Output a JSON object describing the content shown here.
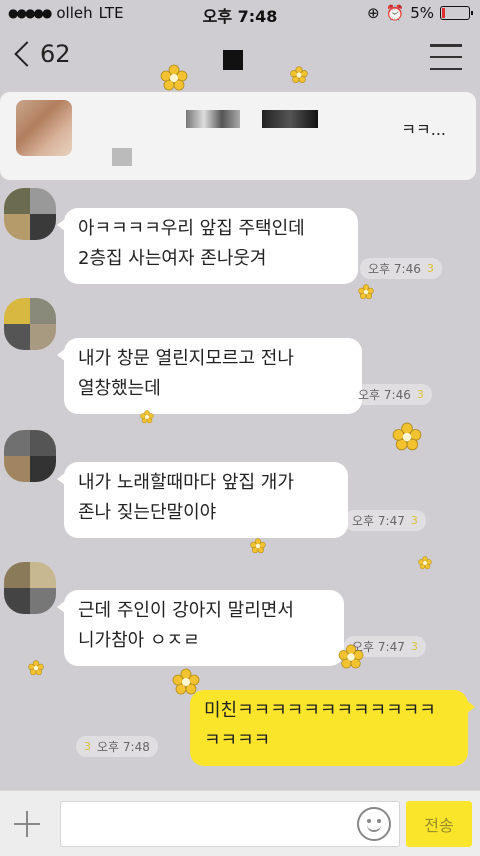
{
  "status_bar": {
    "carrier": "olleh",
    "network": "LTE",
    "time": "오후 7:48",
    "battery": "5%"
  },
  "nav": {
    "back_count": "62",
    "title": ""
  },
  "notice": {
    "text": "ㅋㅋ..."
  },
  "messages": [
    {
      "direction": "in",
      "text": "아ㅋㅋㅋㅋ우리 앞집 주택인데\n2층집 사는여자 존나웃겨",
      "time": "오후 7:46",
      "read": "3"
    },
    {
      "direction": "in",
      "text": "내가 창문 열린지모르고 전나\n열창했는데",
      "time": "오후 7:46",
      "read": "3"
    },
    {
      "direction": "in",
      "text": "내가 노래할때마다 앞집 개가\n존나 짖는단말이야",
      "time": "오후 7:47",
      "read": "3"
    },
    {
      "direction": "in",
      "text": "근데 주인이 강아지 말리면서\n니가참아 ㅇㅈㄹ",
      "time": "오후 7:47",
      "read": "3"
    },
    {
      "direction": "out",
      "text": "미친ㅋㅋㅋㅋㅋㅋㅋㅋㅋㅋㅋㅋ\nㅋㅋㅋㅋ",
      "time": "오후 7:48",
      "read": "3"
    }
  ],
  "input_bar": {
    "placeholder": "",
    "send_label": "전송"
  },
  "colors": {
    "background": "#cfcdd1",
    "incoming_bubble": "#ffffff",
    "outgoing_bubble": "#fbe52a",
    "flower": "#f2c230"
  }
}
